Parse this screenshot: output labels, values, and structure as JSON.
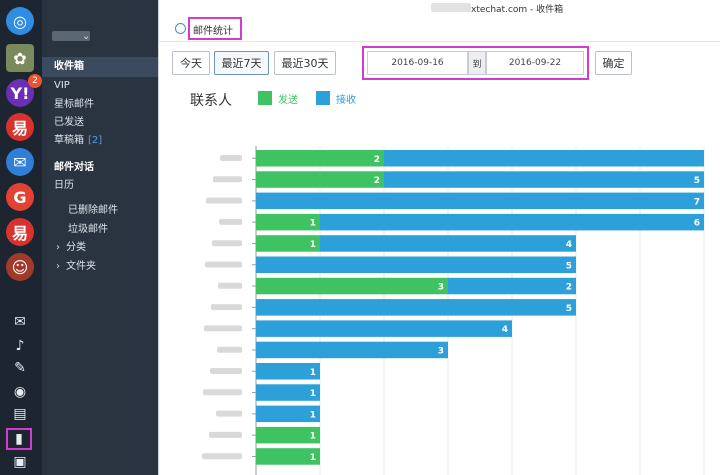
{
  "window": {
    "title_suffix": "xtechat.com - 收件箱"
  },
  "dock": {
    "badge_count": "2",
    "apps": [
      {
        "name": "browser-app-icon",
        "glyph": "◎",
        "color": "#2f8de4"
      },
      {
        "name": "avatar-icon",
        "glyph": "✿",
        "color": "#7a8a5c"
      },
      {
        "name": "yahoo-icon",
        "glyph": "Y!",
        "color": "#6b2fb3"
      },
      {
        "name": "netease-mail-icon",
        "glyph": "易",
        "color": "#d8322e"
      },
      {
        "name": "mailbox-app-icon",
        "glyph": "✉",
        "color": "#2f7fd6"
      },
      {
        "name": "google-icon",
        "glyph": "G",
        "color": "#e34133"
      },
      {
        "name": "netease-mail-alt-icon",
        "glyph": "易",
        "color": "#d8322e"
      },
      {
        "name": "game-avatar-icon",
        "glyph": "☺",
        "color": "#a23a2c"
      }
    ],
    "tools": [
      {
        "name": "wechat-icon",
        "glyph": "✉"
      },
      {
        "name": "music-icon",
        "glyph": "♪"
      },
      {
        "name": "feather-icon",
        "glyph": "✎"
      },
      {
        "name": "qq-icon",
        "glyph": "◉"
      },
      {
        "name": "notebook-icon",
        "glyph": "▤"
      },
      {
        "name": "stats-icon",
        "glyph": "▮"
      },
      {
        "name": "document-icon",
        "glyph": "▣"
      }
    ]
  },
  "sidebar": {
    "items": [
      {
        "label": "收件箱",
        "active": true
      },
      {
        "label": "VIP"
      },
      {
        "label": "星标邮件"
      },
      {
        "label": "已发送"
      },
      {
        "label": "草稿箱",
        "count": "[2]"
      },
      {
        "label": "邮件对话",
        "bold": true
      },
      {
        "label": "日历"
      },
      {
        "label": "已删除邮件"
      },
      {
        "label": "垃圾邮件"
      },
      {
        "label": "分类"
      },
      {
        "label": "文件夹"
      }
    ]
  },
  "tab": {
    "label": "邮件统计"
  },
  "filters": {
    "today": "今天",
    "last7": "最近7天",
    "last30": "最近30天",
    "start_date": "2016-09-16",
    "to": "到",
    "end_date": "2016-09-22",
    "confirm": "确定"
  },
  "legend": {
    "title": "联系人",
    "sent": "发送",
    "received": "接收",
    "sent_color": "#3fc261",
    "received_color": "#2d9fd9"
  },
  "chart_data": {
    "type": "bar",
    "orientation": "horizontal",
    "stacked": true,
    "categories": [
      "",
      "",
      "",
      "",
      "",
      "",
      "",
      "",
      "",
      "",
      "",
      "",
      "",
      "",
      ""
    ],
    "series": [
      {
        "name": "发送",
        "values": [
          2,
          2,
          0,
          1,
          1,
          0,
          3,
          0,
          0,
          0,
          0,
          0,
          0,
          1,
          1
        ]
      },
      {
        "name": "接收",
        "values": [
          5,
          5,
          7,
          6,
          4,
          5,
          2,
          5,
          4,
          3,
          1,
          1,
          1,
          0,
          0
        ]
      }
    ],
    "data_labels": {
      "sent": [
        "2",
        "2",
        "",
        "1",
        "1",
        "",
        "3",
        "",
        "",
        "",
        "",
        "",
        "",
        "1",
        "1"
      ],
      "received": [
        "",
        "5",
        "7",
        "6",
        "4",
        "5",
        "2",
        "5",
        "4",
        "3",
        "1",
        "1",
        "1",
        "",
        ""
      ]
    },
    "grid": true
  }
}
